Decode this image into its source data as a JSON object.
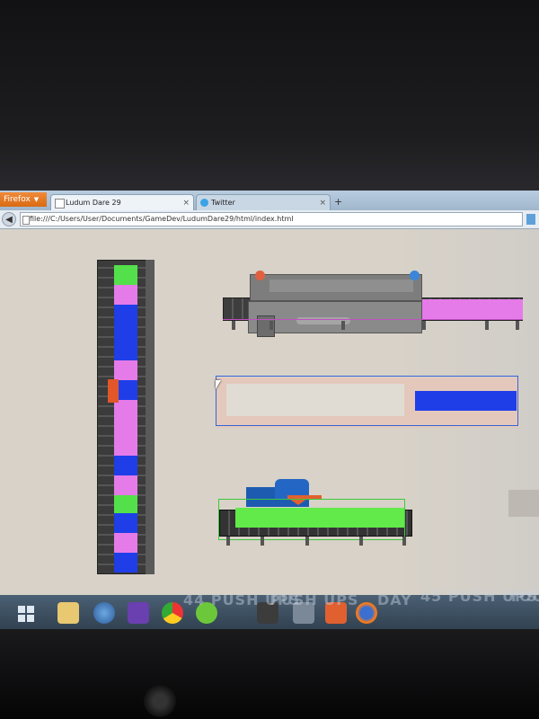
{
  "browser": {
    "app_button": "Firefox",
    "tabs": [
      {
        "label": "Ludum Dare 29",
        "icon": "page-icon"
      },
      {
        "label": "Twitter",
        "icon": "twitter-bird-icon"
      }
    ],
    "new_tab_label": "+",
    "close_label": "×",
    "url": "file:///C:/Users/User/Documents/GameDev/LudumDare29/html/index.html"
  },
  "game": {
    "vertical_belt_blocks": [
      {
        "color": "#54e04a"
      },
      {
        "color": "#e57be8"
      },
      {
        "color": "#1f3ee8"
      },
      {
        "color": "#e57be8"
      },
      {
        "color": "#1f3ee8"
      },
      {
        "color": "#e57be8"
      },
      {
        "color": "#1f3ee8"
      },
      {
        "color": "#e57be8"
      },
      {
        "color": "#54e04a"
      },
      {
        "color": "#1f3ee8"
      },
      {
        "color": "#e57be8"
      },
      {
        "color": "#1f3ee8"
      }
    ],
    "colors": {
      "pink": "#e57be8",
      "blue": "#1f3ee8",
      "green": "#62ea4a",
      "marker": "#e2572a",
      "selection": "#3566d8"
    }
  },
  "taskbar": {
    "apps": [
      "file-explorer-icon",
      "media-center-icon",
      "visual-studio-icon",
      "chrome-icon",
      "spotify-icon",
      "sublime-text-icon",
      "push-ups-icon",
      "git-icon",
      "firefox-icon"
    ],
    "reflection_text": [
      "44 PUSH UPS",
      "PUSH UPS",
      "DAY",
      "45 PUSH UPS",
      "YOU C"
    ]
  }
}
